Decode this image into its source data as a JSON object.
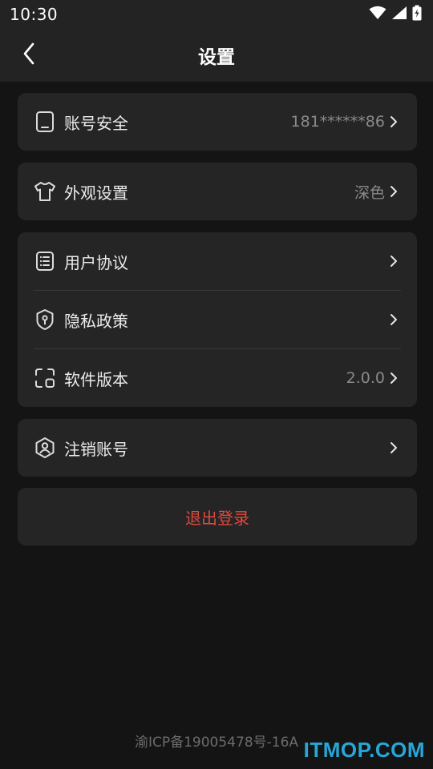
{
  "status_bar": {
    "time": "10:30",
    "icons": [
      "wifi-icon",
      "cellular-signal-icon",
      "battery-charging-icon"
    ]
  },
  "header": {
    "title": "设置",
    "back_icon": "chevron-left-icon"
  },
  "groups": [
    {
      "items": [
        {
          "icon": "phone-icon",
          "label": "账号安全",
          "value": "181******86"
        }
      ]
    },
    {
      "items": [
        {
          "icon": "shirt-icon",
          "label": "外观设置",
          "value": "深色"
        }
      ]
    },
    {
      "items": [
        {
          "icon": "document-list-icon",
          "label": "用户协议",
          "value": ""
        },
        {
          "icon": "shield-key-icon",
          "label": "隐私政策",
          "value": ""
        },
        {
          "icon": "apps-icon",
          "label": "软件版本",
          "value": "2.0.0"
        }
      ]
    },
    {
      "items": [
        {
          "icon": "user-shield-icon",
          "label": "注销账号",
          "value": ""
        }
      ]
    }
  ],
  "logout": {
    "label": "退出登录"
  },
  "footer": {
    "icp": "渝ICP备19005478号-16A"
  },
  "watermark": {
    "text": "ITMOP.COM"
  },
  "colors": {
    "background": "#141414",
    "card": "#252525",
    "logout_text": "#e0483e",
    "watermark": "#27a7d8"
  }
}
